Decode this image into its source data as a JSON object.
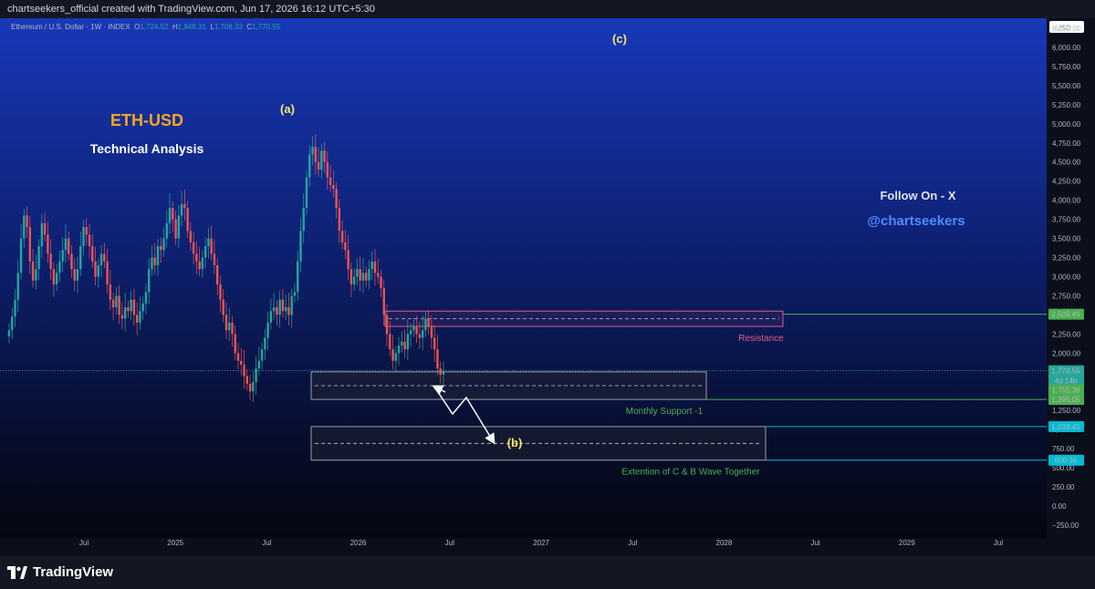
{
  "header": {
    "caption": "chartseekers_official created with TradingView.com, Jun 17, 2026 16:12 UTC+5:30"
  },
  "symbol": {
    "name": "Ethereum / U.S. Dollar · 1W · INDEX",
    "open_label": "O",
    "open": "1,724.52",
    "high_label": "H",
    "high": "1,848.31",
    "low_label": "L",
    "low": "1,708.33",
    "close_label": "C",
    "close": "1,770.55"
  },
  "brand": {
    "name": "TradingView"
  },
  "overlay": {
    "title": "ETH-USD",
    "subtitle": "Technical Analysis",
    "follow": "Follow On - X",
    "handle": "@chartseekers"
  },
  "colors": {
    "up": "#26a69a",
    "down": "#ef5350",
    "resistance": "#e05a8a",
    "support_text": "#4caf50",
    "title": "#f5a623",
    "handle": "#4a8cff",
    "wave_label": "#f5e76a",
    "cyan": "#00bcd4"
  },
  "chart_data": {
    "type": "candlestick",
    "currency": "USD",
    "ylim": [
      -250,
      6250
    ],
    "y_ticks": [
      "6,250.00",
      "6,000.00",
      "5,750.00",
      "5,500.00",
      "5,250.00",
      "5,000.00",
      "4,750.00",
      "4,500.00",
      "4,250.00",
      "4,000.00",
      "3,750.00",
      "3,500.00",
      "3,250.00",
      "3,000.00",
      "2,750.00",
      "2,500.00",
      "2,250.00",
      "2,000.00",
      "1,750.00",
      "1,500.00",
      "1,250.00",
      "1,000.00",
      "750.00",
      "500.00",
      "250.00",
      "0.00",
      "−250.00"
    ],
    "x_ticks": [
      "Jul",
      "2025",
      "Jul",
      "2026",
      "Jul",
      "2027",
      "Jul",
      "2028",
      "Jul",
      "2029",
      "Jul"
    ],
    "price_tags": [
      {
        "label": "2,509.46",
        "value": 2509.46,
        "color": "#4caf50"
      },
      {
        "label": "1,770.55",
        "value": 1770.55,
        "color": "#26a69a"
      },
      {
        "label": "4d 14h",
        "value": 1640,
        "color": "#26a69a"
      },
      {
        "label": "1,755.38",
        "value": 1520,
        "color": "#4caf50"
      },
      {
        "label": "1,395.05",
        "value": 1395.05,
        "color": "#4caf50"
      },
      {
        "label": "1,039.45",
        "value": 1039.45,
        "color": "#00bcd4"
      },
      {
        "label": "600.36",
        "value": 600.36,
        "color": "#00bcd4"
      }
    ],
    "zones": [
      {
        "name": "Resistance",
        "low": 2350,
        "high": 2550,
        "label": "Resistance"
      },
      {
        "name": "Monthly Support",
        "low": 1395.05,
        "high": 1755.38,
        "label": "Monthly Support -1"
      },
      {
        "name": "Extension",
        "low": 600.36,
        "high": 1039.45,
        "label": "Extention of C & B Wave Together"
      }
    ],
    "wave_labels": [
      {
        "label": "(a)",
        "date": "2025-07",
        "value": 5280
      },
      {
        "label": "(b)",
        "date": "2026-10",
        "value": 840
      },
      {
        "label": "(c)",
        "date": "2027-02",
        "value": 5950
      }
    ],
    "closes": [
      2300,
      2480,
      2700,
      3050,
      3500,
      3800,
      3650,
      3200,
      2950,
      3100,
      3400,
      3700,
      3550,
      3300,
      3100,
      2900,
      3050,
      3200,
      3350,
      3500,
      3300,
      3100,
      2950,
      3100,
      3400,
      3650,
      3550,
      3400,
      3200,
      3000,
      3150,
      3300,
      3200,
      2900,
      2700,
      2600,
      2750,
      2500,
      2450,
      2600,
      2550,
      2700,
      2500,
      2400,
      2550,
      2650,
      2800,
      3100,
      3250,
      3150,
      3400,
      3350,
      3500,
      3700,
      3900,
      3750,
      3500,
      3800,
      3950,
      3900,
      3600,
      3450,
      3300,
      3200,
      3100,
      3250,
      3400,
      3500,
      3300,
      3150,
      2900,
      2700,
      2500,
      2300,
      2400,
      2250,
      2000,
      1900,
      1850,
      1700,
      1600,
      1500,
      1620,
      1800,
      1900,
      2050,
      2200,
      2400,
      2550,
      2600,
      2500,
      2700,
      2550,
      2600,
      2500,
      2750,
      2800,
      3200,
      3600,
      3900,
      4300,
      4600,
      4700,
      4500,
      4400,
      4650,
      4500,
      4300,
      4200,
      4150,
      3900,
      3600,
      3450,
      3350,
      3100,
      2900,
      3000,
      3100,
      2950,
      3050,
      2950,
      3100,
      3200,
      3050,
      3000,
      2850,
      2500,
      2250,
      2050,
      1900,
      2000,
      2100,
      2150,
      2050,
      2250,
      2300,
      2350,
      2250,
      2200,
      2300,
      2450,
      2350,
      2200,
      2050,
      1800,
      1720,
      1771
    ]
  }
}
